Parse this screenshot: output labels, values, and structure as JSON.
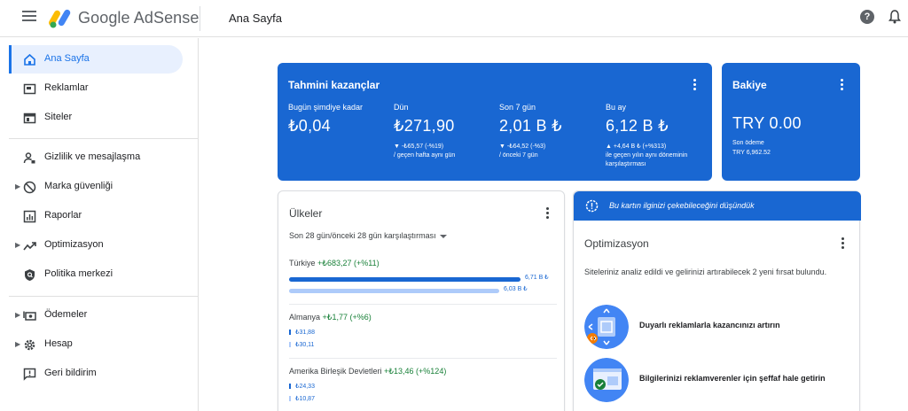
{
  "header": {
    "brand": "Google AdSense",
    "page_title": "Ana Sayfa",
    "help_glyph": "?"
  },
  "sidebar": {
    "items": [
      {
        "label": "Ana Sayfa",
        "icon": "home-icon"
      },
      {
        "label": "Reklamlar",
        "icon": "ads-icon"
      },
      {
        "label": "Siteler",
        "icon": "sites-icon"
      },
      {
        "label": "Gizlilik ve mesajlaşma",
        "icon": "privacy-icon"
      },
      {
        "label": "Marka güvenliği",
        "icon": "block-icon"
      },
      {
        "label": "Raporlar",
        "icon": "reports-icon"
      },
      {
        "label": "Optimizasyon",
        "icon": "trending-icon"
      },
      {
        "label": "Politika merkezi",
        "icon": "policy-icon"
      },
      {
        "label": "Ödemeler",
        "icon": "payments-icon"
      },
      {
        "label": "Hesap",
        "icon": "settings-icon"
      },
      {
        "label": "Geri bildirim",
        "icon": "feedback-icon"
      }
    ]
  },
  "earnings": {
    "title": "Tahmini kazançlar",
    "columns": [
      {
        "label": "Bugün şimdiye kadar",
        "value": "₺0,04",
        "change": "",
        "compare": ""
      },
      {
        "label": "Dün",
        "value": "₺271,90",
        "change": "▼ -₺65,57 (-%19)",
        "compare": "/ geçen hafta aynı gün"
      },
      {
        "label": "Son 7 gün",
        "value": "2,01 B ₺",
        "change": "▼ -₺64,52 (-%3)",
        "compare": "/ önceki 7 gün"
      },
      {
        "label": "Bu ay",
        "value": "6,12 B ₺",
        "change": "▲ +4,64 B ₺ (+%313)",
        "compare": "ile geçen yılın aynı döneminin karşılaştırması"
      }
    ]
  },
  "balance": {
    "title": "Bakiye",
    "value": "TRY 0.00",
    "last_payment_label": "Son ödeme",
    "last_payment_value": "TRY 6,962.52"
  },
  "countries": {
    "title": "Ülkeler",
    "filter": "Son 28 gün/önceki 28 gün karşılaştırması",
    "rows": [
      {
        "name": "Türkiye",
        "change": "+₺683,27 (+%11)",
        "current": "6,71 B ₺",
        "previous": "6,03 B ₺"
      },
      {
        "name": "Almanya",
        "change": "+₺1,77 (+%6)",
        "current": "₺31,88",
        "previous": "₺30,11"
      },
      {
        "name": "Amerika Birleşik Devletleri",
        "change": "+₺13,46 (+%124)",
        "current": "₺24,33",
        "previous": "₺10,87"
      }
    ]
  },
  "optimization": {
    "banner": "Bu kartın ilginizi çekebileceğini düşündük",
    "title": "Optimizasyon",
    "description": "Siteleriniz analiz edildi ve gelirinizi artırabilecek 2 yeni fırsat bulundu.",
    "items": [
      {
        "label": "Duyarlı reklamlarla kazancınızı artırın"
      },
      {
        "label": "Bilgilerinizi reklamverenler için şeffaf hale getirin"
      }
    ]
  },
  "colors": {
    "accent_blue": "#1967d2",
    "positive_green": "#188038",
    "previous_bar": "#aecbfa"
  }
}
